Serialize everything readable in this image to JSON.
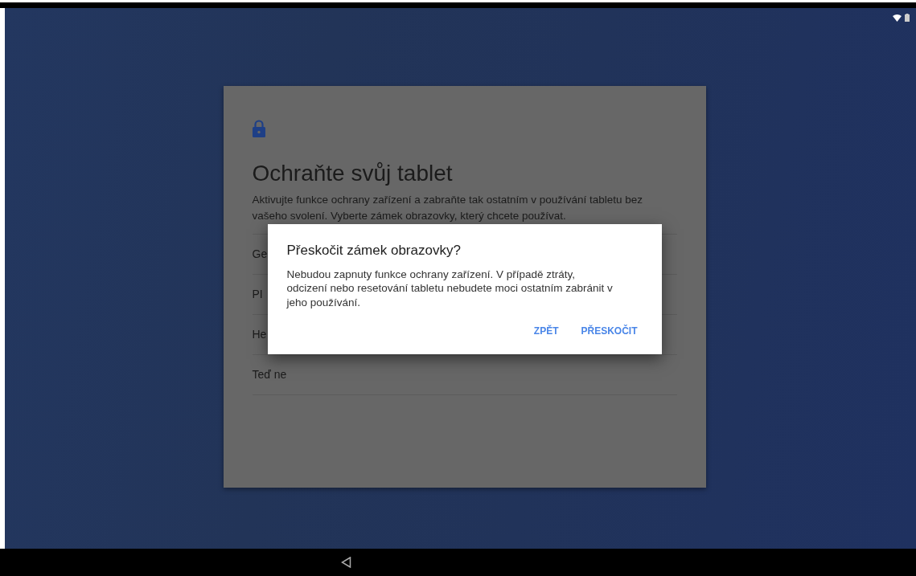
{
  "setup_card": {
    "title": "Ochraňte svůj tablet",
    "description": "Aktivujte funkce ochrany zařízení a zabraňte tak ostatním v používání tabletu bez vašeho svolení. Vyberte zámek obrazovky, který chcete používat.",
    "options": [
      {
        "label": "Ge"
      },
      {
        "label": "PI"
      },
      {
        "label": "He"
      },
      {
        "label": "Teď ne"
      }
    ]
  },
  "dialog": {
    "title": "Přeskočit zámek obrazovky?",
    "message": "Nebudou zapnuty funkce ochrany zařízení. V případě ztráty, odcizení nebo resetování tabletu nebudete moci ostatním zabránit v jeho používání.",
    "buttons": [
      {
        "label": "ZPĚT"
      },
      {
        "label": "PŘESKOČIT"
      }
    ]
  }
}
